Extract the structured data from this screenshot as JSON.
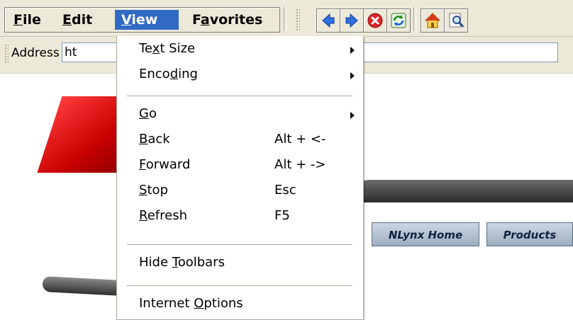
{
  "menubar": {
    "items": [
      {
        "label_pre": "",
        "label_u": "F",
        "label_post": "ile"
      },
      {
        "label_pre": "",
        "label_u": "E",
        "label_post": "dit"
      },
      {
        "label_pre": "",
        "label_u": "V",
        "label_post": "iew"
      },
      {
        "label_pre": "F",
        "label_u": "a",
        "label_post": "vorites"
      }
    ],
    "active_index": 2
  },
  "toolbar": {
    "buttons": [
      {
        "icon": "back-arrow-icon"
      },
      {
        "icon": "forward-arrow-icon"
      },
      {
        "icon": "stop-icon"
      },
      {
        "icon": "refresh-icon"
      },
      {
        "icon": "home-icon"
      },
      {
        "icon": "search-icon"
      }
    ]
  },
  "addressbar": {
    "label": "Address",
    "value": "ht"
  },
  "page": {
    "tabs": [
      "NLynx Home",
      "Products"
    ]
  },
  "view_menu": {
    "items": [
      {
        "pre": "Te",
        "u": "x",
        "post": "t Size",
        "shortcut": "",
        "submenu": true
      },
      {
        "pre": "Enco",
        "u": "d",
        "post": "ing",
        "shortcut": "",
        "submenu": true
      },
      {
        "pre": "",
        "u": "G",
        "post": "o",
        "shortcut": "",
        "submenu": true
      },
      {
        "pre": "",
        "u": "B",
        "post": "ack",
        "shortcut": "Alt + <-",
        "submenu": false
      },
      {
        "pre": "",
        "u": "F",
        "post": "orward",
        "shortcut": "Alt + ->",
        "submenu": false
      },
      {
        "pre": "",
        "u": "S",
        "post": "top",
        "shortcut": "Esc",
        "submenu": false
      },
      {
        "pre": "",
        "u": "R",
        "post": "efresh",
        "shortcut": "F5",
        "submenu": false
      },
      {
        "pre": "Hide ",
        "u": "T",
        "post": "oolbars",
        "shortcut": "",
        "submenu": false
      },
      {
        "pre": "Internet ",
        "u": "O",
        "post": "ptions",
        "shortcut": "",
        "submenu": false
      }
    ]
  },
  "colors": {
    "menu_highlight": "#316ac5",
    "toolbar_bg": "#ece9d8",
    "logo_red": "#d40000"
  }
}
